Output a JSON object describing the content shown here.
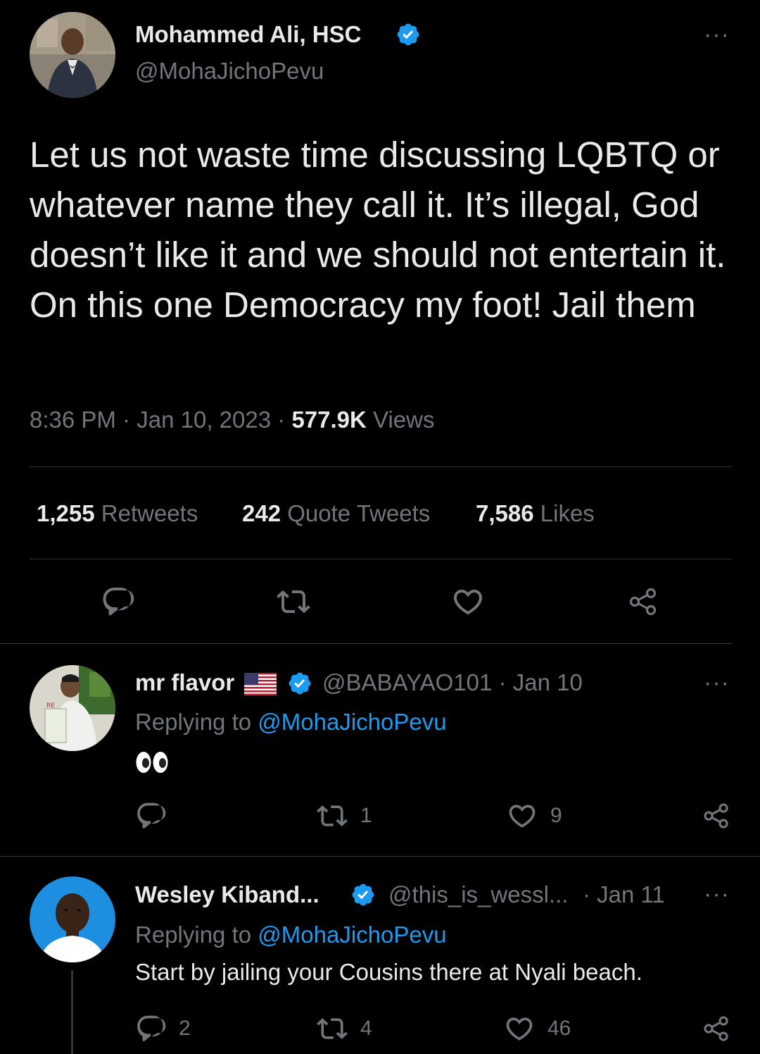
{
  "main_tweet": {
    "author_name": "Mohammed Ali, HSC",
    "handle": "@MohaJichoPevu",
    "text": "Let us not waste time discussing LQBTQ or whatever name they call it. It’s illegal, God doesn’t like it and we should not entertain it. On this one Democracy my foot! Jail them",
    "time": "8:36 PM",
    "date": "Jan 10, 2023",
    "views_count": "577.9K",
    "views_label": "Views",
    "retweets_count": "1,255",
    "retweets_label": "Retweets",
    "quotes_count": "242",
    "quotes_label": "Quote Tweets",
    "likes_count": "7,586",
    "likes_label": "Likes",
    "more": "···"
  },
  "replies": [
    {
      "author_name": "mr flavor",
      "handle": "@BABAYAO101",
      "date": "· Jan 10",
      "replying_prefix": "Replying to",
      "replying_to": "@MohaJichoPevu",
      "text": "👀",
      "reply_count": "",
      "retweet_count": "1",
      "like_count": "9",
      "more": "···"
    },
    {
      "author_name": "Wesley Kiband...",
      "handle": "@this_is_wessl...",
      "date": "· Jan 11",
      "replying_prefix": "Replying to",
      "replying_to": "@MohaJichoPevu",
      "text": "Start by jailing your Cousins there at Nyali beach.",
      "reply_count": "2",
      "retweet_count": "4",
      "like_count": "46",
      "more": "···"
    }
  ],
  "colors": {
    "background": "#000000",
    "primary_text": "#E7E9EA",
    "secondary_text": "#71767B",
    "accent": "#1D9BF0",
    "divider": "#2F3336"
  },
  "icons": [
    "verified-badge-icon",
    "reply-icon",
    "retweet-icon",
    "like-icon",
    "share-icon",
    "more-icon",
    "us-flag-icon",
    "eyes-emoji"
  ]
}
